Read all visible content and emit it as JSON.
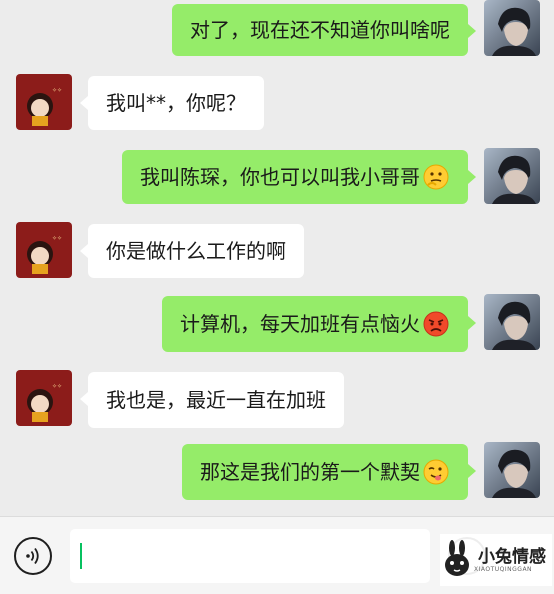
{
  "messages": [
    {
      "side": "out",
      "text": "对了，现在还不知道你叫啥呢",
      "emoji": ""
    },
    {
      "side": "in",
      "text": "我叫**，你呢？",
      "emoji": ""
    },
    {
      "side": "out",
      "text": "我叫陈琛，你也可以叫我小哥哥",
      "emoji": "thinking-face"
    },
    {
      "side": "in",
      "text": "你是做什么工作的啊",
      "emoji": ""
    },
    {
      "side": "out",
      "text": "计算机，每天加班有点恼火",
      "emoji": "angry-face"
    },
    {
      "side": "in",
      "text": "我也是，最近一直在加班",
      "emoji": ""
    },
    {
      "side": "out",
      "text": "那这是我们的第一个默契",
      "emoji": "winking-tongue-face"
    }
  ],
  "input": {
    "value": ""
  },
  "watermark": {
    "title": "小兔情感",
    "subtitle": "XIAOTUQINGGAN"
  },
  "colors": {
    "outgoing_bubble": "#95ec69",
    "incoming_bubble": "#ffffff",
    "background": "#ececec"
  }
}
